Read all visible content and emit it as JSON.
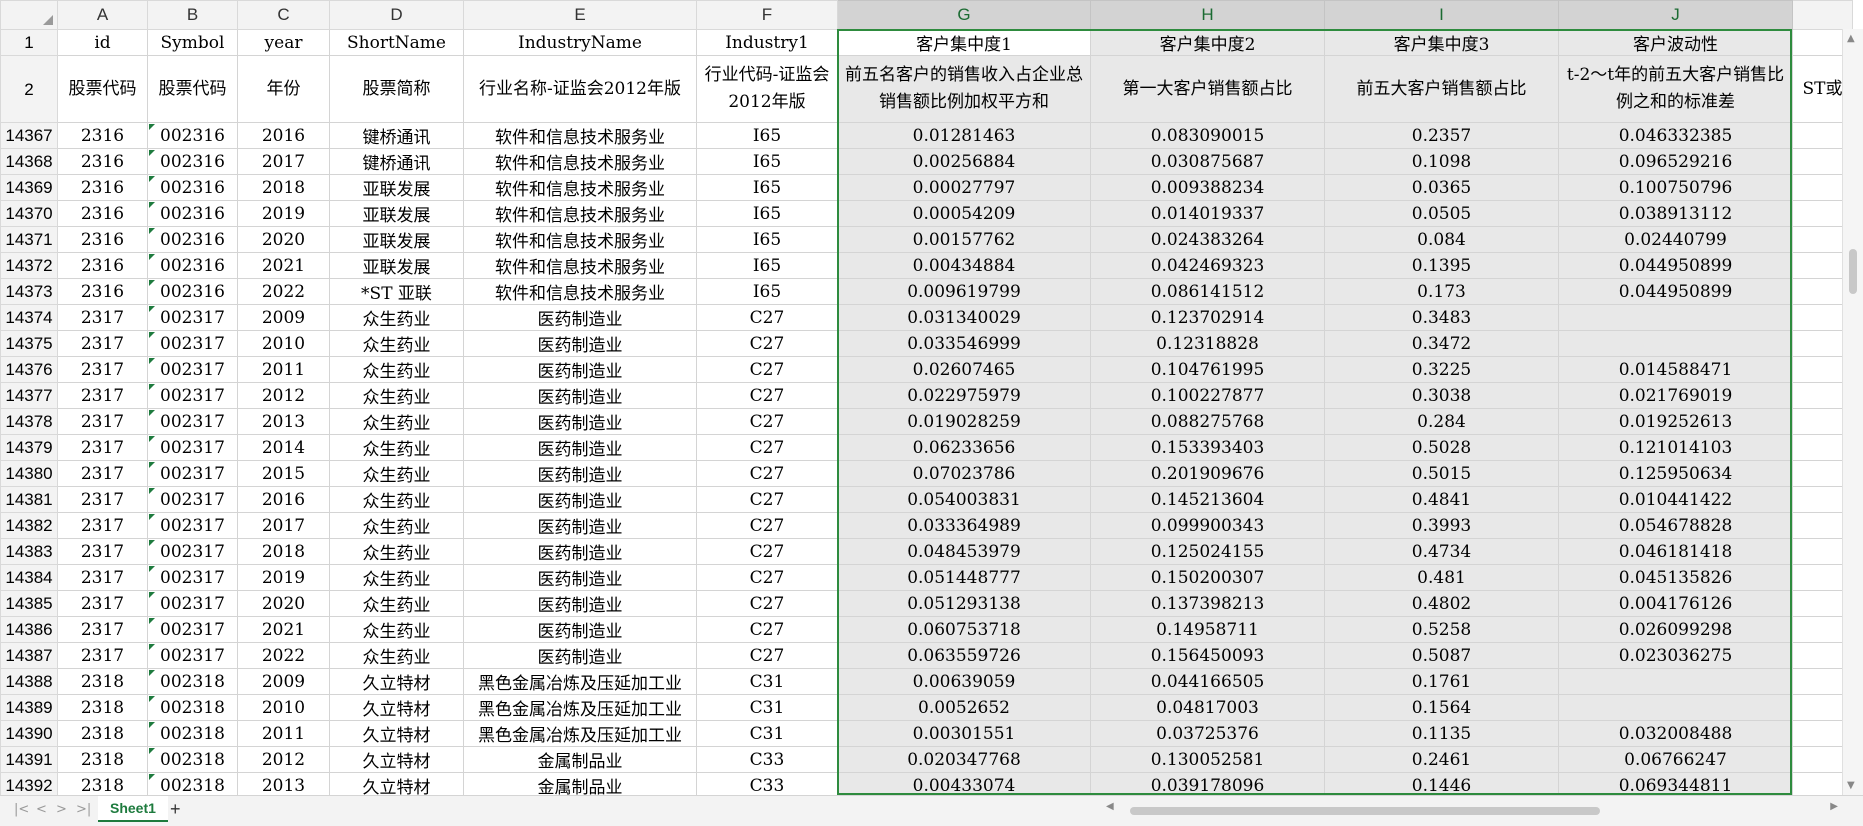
{
  "columns": [
    "A",
    "B",
    "C",
    "D",
    "E",
    "F",
    "G",
    "H",
    "I",
    "J",
    ""
  ],
  "header_row1": {
    "num": "1",
    "cells": [
      "id",
      "Symbol",
      "year",
      "ShortName",
      "IndustryName",
      "Industry1",
      "客户集中度1",
      "客户集中度2",
      "客户集中度3",
      "客户波动性",
      ""
    ]
  },
  "header_row2": {
    "num": "2",
    "cells": [
      "股票代码",
      "股票代码",
      "年份",
      "股票简称",
      "行业名称-证监会2012年版",
      "行业代码-证监会2012年版",
      "前五名客户的销售收入占企业总销售额比例加权平方和",
      "第一大客户销售额占比",
      "前五大客户销售额占比",
      "t-2～t年的前五大客户销售比例之和的标准差",
      "ST或"
    ]
  },
  "rows": [
    {
      "num": "14367",
      "cells": [
        "2316",
        "002316",
        "2016",
        "键桥通讯",
        "软件和信息技术服务业",
        "I65",
        "0.01281463",
        "0.083090015",
        "0.2357",
        "0.046332385",
        ""
      ]
    },
    {
      "num": "14368",
      "cells": [
        "2316",
        "002316",
        "2017",
        "键桥通讯",
        "软件和信息技术服务业",
        "I65",
        "0.00256884",
        "0.030875687",
        "0.1098",
        "0.096529216",
        ""
      ]
    },
    {
      "num": "14369",
      "cells": [
        "2316",
        "002316",
        "2018",
        "亚联发展",
        "软件和信息技术服务业",
        "I65",
        "0.00027797",
        "0.009388234",
        "0.0365",
        "0.100750796",
        ""
      ]
    },
    {
      "num": "14370",
      "cells": [
        "2316",
        "002316",
        "2019",
        "亚联发展",
        "软件和信息技术服务业",
        "I65",
        "0.00054209",
        "0.014019337",
        "0.0505",
        "0.038913112",
        ""
      ]
    },
    {
      "num": "14371",
      "cells": [
        "2316",
        "002316",
        "2020",
        "亚联发展",
        "软件和信息技术服务业",
        "I65",
        "0.00157762",
        "0.024383264",
        "0.084",
        "0.02440799",
        ""
      ]
    },
    {
      "num": "14372",
      "cells": [
        "2316",
        "002316",
        "2021",
        "亚联发展",
        "软件和信息技术服务业",
        "I65",
        "0.00434884",
        "0.042469323",
        "0.1395",
        "0.044950899",
        ""
      ]
    },
    {
      "num": "14373",
      "cells": [
        "2316",
        "002316",
        "2022",
        "*ST 亚联",
        "软件和信息技术服务业",
        "I65",
        "0.009619799",
        "0.086141512",
        "0.173",
        "0.044950899",
        ""
      ]
    },
    {
      "num": "14374",
      "cells": [
        "2317",
        "002317",
        "2009",
        "众生药业",
        "医药制造业",
        "C27",
        "0.031340029",
        "0.123702914",
        "0.3483",
        "",
        ""
      ]
    },
    {
      "num": "14375",
      "cells": [
        "2317",
        "002317",
        "2010",
        "众生药业",
        "医药制造业",
        "C27",
        "0.033546999",
        "0.12318828",
        "0.3472",
        "",
        ""
      ]
    },
    {
      "num": "14376",
      "cells": [
        "2317",
        "002317",
        "2011",
        "众生药业",
        "医药制造业",
        "C27",
        "0.02607465",
        "0.104761995",
        "0.3225",
        "0.014588471",
        ""
      ]
    },
    {
      "num": "14377",
      "cells": [
        "2317",
        "002317",
        "2012",
        "众生药业",
        "医药制造业",
        "C27",
        "0.022975979",
        "0.100227877",
        "0.3038",
        "0.021769019",
        ""
      ]
    },
    {
      "num": "14378",
      "cells": [
        "2317",
        "002317",
        "2013",
        "众生药业",
        "医药制造业",
        "C27",
        "0.019028259",
        "0.088275768",
        "0.284",
        "0.019252613",
        ""
      ]
    },
    {
      "num": "14379",
      "cells": [
        "2317",
        "002317",
        "2014",
        "众生药业",
        "医药制造业",
        "C27",
        "0.06233656",
        "0.153393403",
        "0.5028",
        "0.121014103",
        ""
      ]
    },
    {
      "num": "14380",
      "cells": [
        "2317",
        "002317",
        "2015",
        "众生药业",
        "医药制造业",
        "C27",
        "0.07023786",
        "0.201909676",
        "0.5015",
        "0.125950634",
        ""
      ]
    },
    {
      "num": "14381",
      "cells": [
        "2317",
        "002317",
        "2016",
        "众生药业",
        "医药制造业",
        "C27",
        "0.054003831",
        "0.145213604",
        "0.4841",
        "0.010441422",
        ""
      ]
    },
    {
      "num": "14382",
      "cells": [
        "2317",
        "002317",
        "2017",
        "众生药业",
        "医药制造业",
        "C27",
        "0.033364989",
        "0.099900343",
        "0.3993",
        "0.054678828",
        ""
      ]
    },
    {
      "num": "14383",
      "cells": [
        "2317",
        "002317",
        "2018",
        "众生药业",
        "医药制造业",
        "C27",
        "0.048453979",
        "0.125024155",
        "0.4734",
        "0.046181418",
        ""
      ]
    },
    {
      "num": "14384",
      "cells": [
        "2317",
        "002317",
        "2019",
        "众生药业",
        "医药制造业",
        "C27",
        "0.051448777",
        "0.150200307",
        "0.481",
        "0.045135826",
        ""
      ]
    },
    {
      "num": "14385",
      "cells": [
        "2317",
        "002317",
        "2020",
        "众生药业",
        "医药制造业",
        "C27",
        "0.051293138",
        "0.137398213",
        "0.4802",
        "0.004176126",
        ""
      ]
    },
    {
      "num": "14386",
      "cells": [
        "2317",
        "002317",
        "2021",
        "众生药业",
        "医药制造业",
        "C27",
        "0.060753718",
        "0.14958711",
        "0.5258",
        "0.026099298",
        ""
      ]
    },
    {
      "num": "14387",
      "cells": [
        "2317",
        "002317",
        "2022",
        "众生药业",
        "医药制造业",
        "C27",
        "0.063559726",
        "0.156450093",
        "0.5087",
        "0.023036275",
        ""
      ]
    },
    {
      "num": "14388",
      "cells": [
        "2318",
        "002318",
        "2009",
        "久立特材",
        "黑色金属冶炼及压延加工业",
        "C31",
        "0.00639059",
        "0.044166505",
        "0.1761",
        "",
        ""
      ]
    },
    {
      "num": "14389",
      "cells": [
        "2318",
        "002318",
        "2010",
        "久立特材",
        "黑色金属冶炼及压延加工业",
        "C31",
        "0.0052652",
        "0.04817003",
        "0.1564",
        "",
        ""
      ]
    },
    {
      "num": "14390",
      "cells": [
        "2318",
        "002318",
        "2011",
        "久立特材",
        "黑色金属冶炼及压延加工业",
        "C31",
        "0.00301551",
        "0.03725376",
        "0.1135",
        "0.032008488",
        ""
      ]
    },
    {
      "num": "14391",
      "cells": [
        "2318",
        "002318",
        "2012",
        "久立特材",
        "金属制品业",
        "C33",
        "0.020347768",
        "0.130052581",
        "0.2461",
        "0.06766247",
        ""
      ]
    },
    {
      "num": "14392",
      "cells": [
        "2318",
        "002318",
        "2013",
        "久立特材",
        "金属制品业",
        "C33",
        "0.00433074",
        "0.039178096",
        "0.1446",
        "0.069344811",
        ""
      ]
    }
  ],
  "sheet_tab": "Sheet1",
  "add_tab": "+",
  "nav": [
    "|<",
    "<",
    ">",
    ">|"
  ],
  "colors": {
    "accent": "#1e7b3e",
    "selection_border": "#2e8b3e",
    "selection_fill": "#e8e8e8"
  }
}
